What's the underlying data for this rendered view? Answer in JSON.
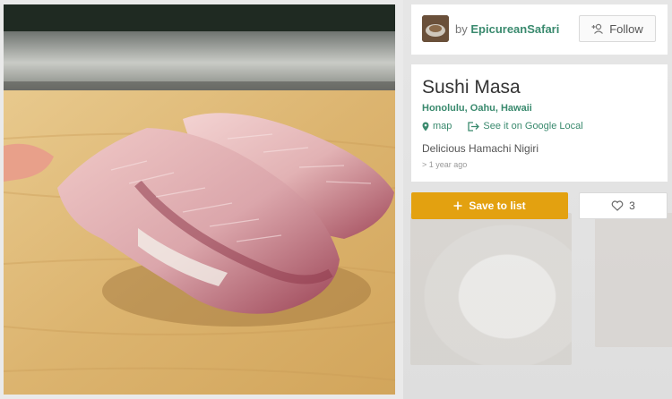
{
  "author": {
    "by_label": "by",
    "name": "EpicureanSafari",
    "follow_label": "Follow",
    "avatar_icon": "avatar-image",
    "follow_icon": "add-user-icon"
  },
  "place": {
    "title": "Sushi Masa",
    "location": "Honolulu, Oahu, Hawaii",
    "map_label": "map",
    "google_label": "See it on Google Local",
    "description": "Delicious Hamachi Nigiri",
    "time_ago": "> 1 year ago"
  },
  "actions": {
    "save_label": "Save to list",
    "like_count": "3"
  },
  "colors": {
    "accent_green": "#3a8a6e",
    "save_orange": "#e3a110"
  },
  "photo": {
    "subject": "Hamachi nigiri sushi on a wooden counter"
  }
}
